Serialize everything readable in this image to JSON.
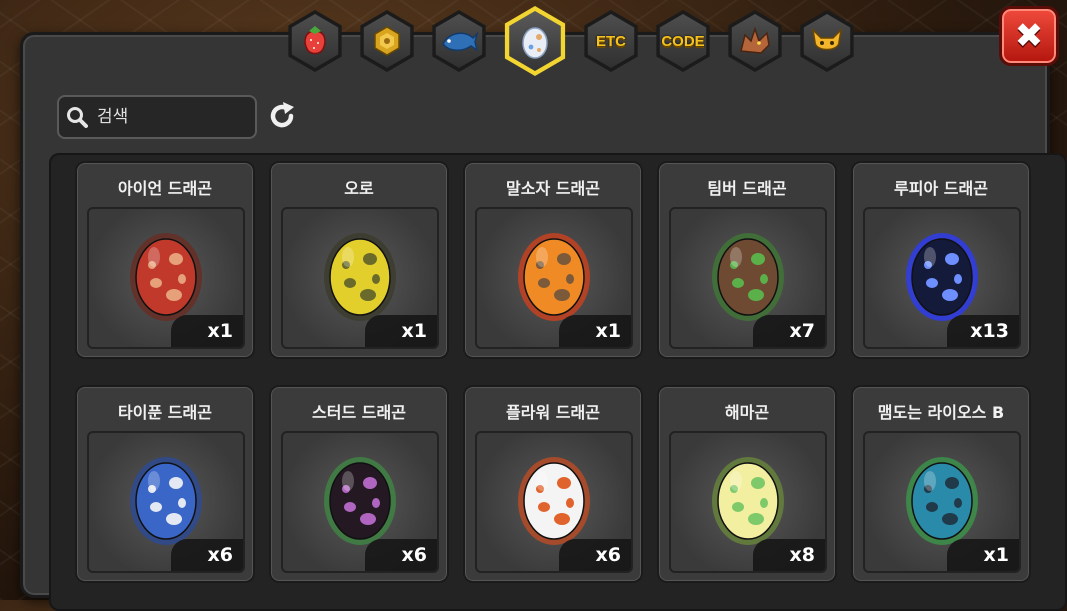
{
  "search": {
    "placeholder": "검색"
  },
  "tabs": [
    {
      "id": "fruit",
      "icon": "strawberry-icon",
      "active": false
    },
    {
      "id": "gold",
      "icon": "gold-coin-icon",
      "active": false
    },
    {
      "id": "fish",
      "icon": "fish-icon",
      "active": false
    },
    {
      "id": "egg",
      "icon": "egg-icon",
      "active": true
    },
    {
      "id": "etc",
      "label": "ETC",
      "active": false
    },
    {
      "id": "code",
      "label": "CODE",
      "active": false
    },
    {
      "id": "dragon",
      "icon": "dragon-head-icon",
      "active": false
    },
    {
      "id": "monster",
      "icon": "monster-face-icon",
      "active": false
    }
  ],
  "items": [
    {
      "name": "아이언 드래곤",
      "count": "x1",
      "base": "#c0392b",
      "spot": "#e6a07a",
      "glow": "#6b2a20"
    },
    {
      "name": "오로",
      "count": "x1",
      "base": "#e3cf2b",
      "spot": "#6a6a2a",
      "glow": "#3a3a2a"
    },
    {
      "name": "말소자 드래곤",
      "count": "x1",
      "base": "#f08a24",
      "spot": "#7a5a3a",
      "glow": "#d6401a"
    },
    {
      "name": "팀버 드래곤",
      "count": "x7",
      "base": "#6e4a32",
      "spot": "#5bb04a",
      "glow": "#3f7a34"
    },
    {
      "name": "루피아 드래곤",
      "count": "x13",
      "base": "#141a3a",
      "spot": "#6d8fff",
      "glow": "#2b3aff"
    },
    {
      "name": "타이푼 드래곤",
      "count": "x6",
      "base": "#3a66c8",
      "spot": "#e4e8f2",
      "glow": "#2a4a9a"
    },
    {
      "name": "스터드 드래곤",
      "count": "x6",
      "base": "#241822",
      "spot": "#b066c0",
      "glow": "#3e8a42"
    },
    {
      "name": "플라워 드래곤",
      "count": "x6",
      "base": "#f4f4f4",
      "spot": "#e0632e",
      "glow": "#c44b22"
    },
    {
      "name": "해마곤",
      "count": "x8",
      "base": "#f3efa0",
      "spot": "#7ec96a",
      "glow": "#6a8a3a"
    },
    {
      "name": "맴도는 라이오스 B",
      "count": "x1",
      "base": "#2a8aaa",
      "spot": "#203a4a",
      "glow": "#3a9a4a"
    }
  ],
  "colors": {
    "accent": "#f2d531",
    "close": "#e0301f",
    "panel": "#353535"
  }
}
